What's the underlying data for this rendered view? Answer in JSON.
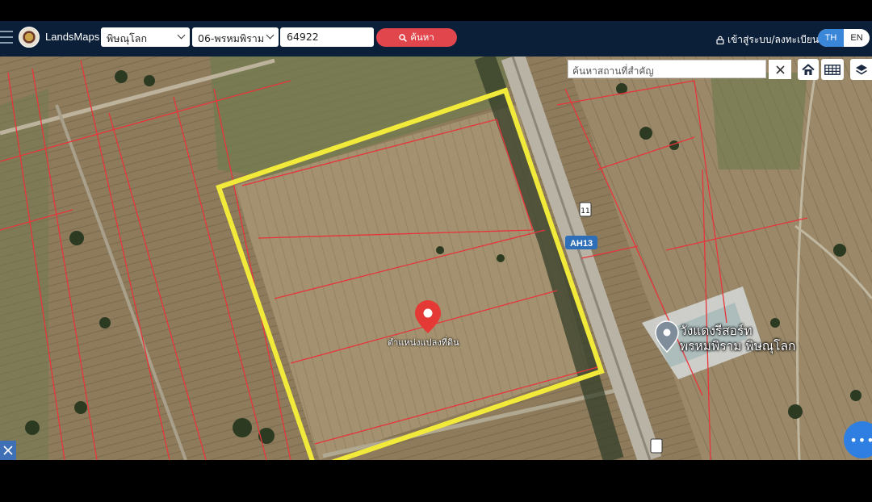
{
  "navbar": {
    "brand": "LandsMaps",
    "province": "พิษณุโลก",
    "district": "06-พรหมพิราม",
    "parcel_no": "64922",
    "search_label": "ค้นหา",
    "login_label": "เข้าสู่ระบบ/ลงทะเบียน",
    "lang_th": "TH",
    "lang_en": "EN"
  },
  "map": {
    "place_search_placeholder": "ค้นหาสถานที่สำคัญ",
    "highway_number": "11",
    "asian_highway": "AH13",
    "pin_label": "ตำแหน่งแปลงที่ดิน",
    "poi_label_line1": "วังแดงรีสอร์ท",
    "poi_label_line2": "พรหมพิราม พิษณุโลก",
    "fab_label": "•••"
  },
  "colors": {
    "navbar": "#0b1f38",
    "search_button": "#e0464c",
    "lang_active": "#3a86d8",
    "parcel_boundary": "#e8343a",
    "highlight_box": "#f2ea3a",
    "pin": "#e53935",
    "fab": "#2f7fe3"
  }
}
